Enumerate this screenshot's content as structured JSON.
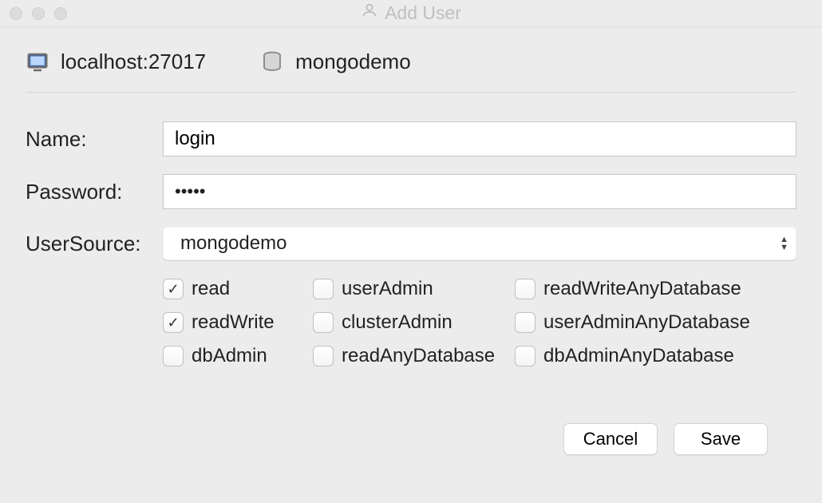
{
  "window": {
    "title": "Add User"
  },
  "breadcrumb": {
    "host": "localhost:27017",
    "database": "mongodemo"
  },
  "form": {
    "name_label": "Name:",
    "name_value": "login",
    "password_label": "Password:",
    "password_mask": "•••••",
    "usersource_label": "UserSource:",
    "usersource_value": "mongodemo"
  },
  "roles": [
    {
      "label": "read",
      "checked": true
    },
    {
      "label": "userAdmin",
      "checked": false
    },
    {
      "label": "readWriteAnyDatabase",
      "checked": false
    },
    {
      "label": "readWrite",
      "checked": true
    },
    {
      "label": "clusterAdmin",
      "checked": false
    },
    {
      "label": "userAdminAnyDatabase",
      "checked": false
    },
    {
      "label": "dbAdmin",
      "checked": false
    },
    {
      "label": "readAnyDatabase",
      "checked": false
    },
    {
      "label": "dbAdminAnyDatabase",
      "checked": false
    }
  ],
  "buttons": {
    "cancel": "Cancel",
    "save": "Save"
  }
}
